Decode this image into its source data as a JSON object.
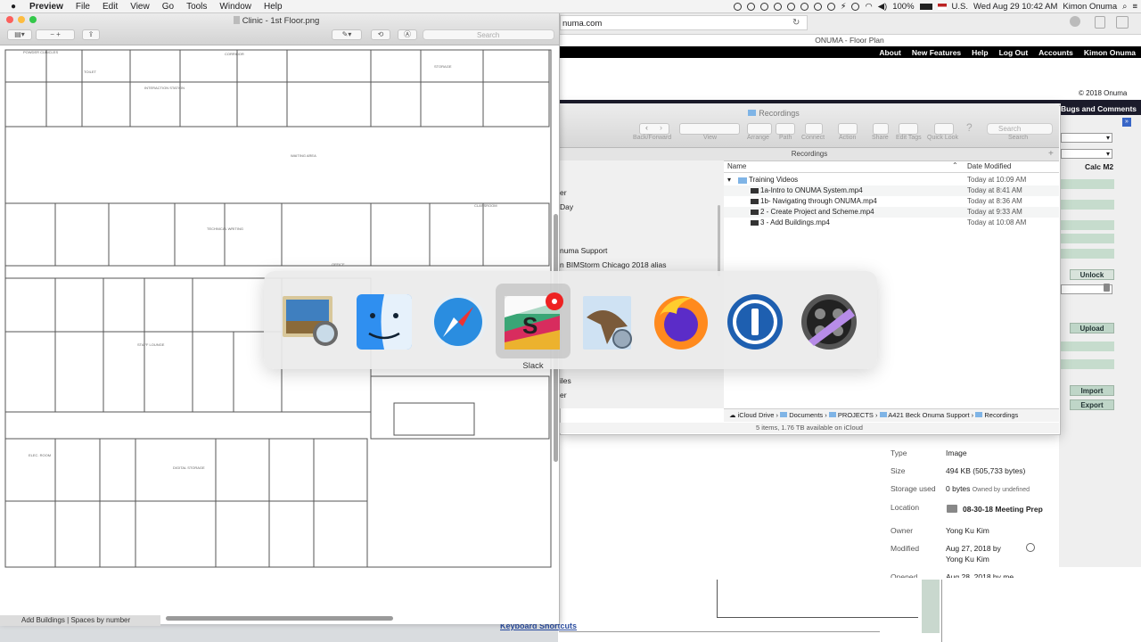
{
  "menubar": {
    "apple": "",
    "items": [
      "Preview",
      "File",
      "Edit",
      "View",
      "Go",
      "Tools",
      "Window",
      "Help"
    ],
    "status": {
      "battery": "100%",
      "input": "U.S.",
      "datetime": "Wed Aug 29  10:42 AM",
      "user": "Kimon Onuma"
    }
  },
  "preview": {
    "title": "Clinic - 1st Floor.png",
    "search_placeholder": "Search",
    "bottom_peek": "Add Buildings | Spaces by number"
  },
  "browser": {
    "address_partial": "numa.com",
    "page_title": "ONUMA - Floor Plan",
    "nav": [
      "About",
      "New Features",
      "Help",
      "Log Out",
      "Accounts",
      "Kimon Onuma"
    ],
    "copyright": "© 2018 Onuma",
    "bugs": "Bugs and Comments",
    "calc": "Calc M2",
    "buttons": {
      "unlock": "Unlock",
      "upload": "Upload",
      "import": "Import",
      "export": "Export"
    },
    "keyboard_shortcuts": "Keyboard Shortcuts"
  },
  "finder": {
    "title": "Recordings",
    "toolbar": [
      "Back/Forward",
      "View",
      "Arrange",
      "Path",
      "Connect",
      "Action",
      "Share",
      "Edit Tags",
      "Quick Look",
      "Search"
    ],
    "search_placeholder": "Search",
    "tab_title": "Recordings",
    "sidebar": [
      "er",
      "Day",
      "numa Support",
      "n BIMStorm Chicago 2018 alias",
      "iles",
      "er"
    ],
    "columns": {
      "name": "Name",
      "date": "Date Modified"
    },
    "rows": [
      {
        "name": "Training Videos",
        "date": "Today at 10:09 AM",
        "folder": true
      },
      {
        "name": "1a-Intro to ONUMA System.mp4",
        "date": "Today at 8:41 AM"
      },
      {
        "name": "1b- Navigating through ONUMA.mp4",
        "date": "Today at 8:36 AM"
      },
      {
        "name": "2 - Create Project and Scheme.mp4",
        "date": "Today at 9:33 AM"
      },
      {
        "name": "3 - Add Buildings.mp4",
        "date": "Today at 10:08 AM"
      }
    ],
    "path": [
      "iCloud Drive",
      "Documents",
      "PROJECTS",
      "A421 Beck Onuma Support",
      "Recordings"
    ],
    "status": "5 items, 1.76 TB available on iCloud"
  },
  "info": {
    "type_label": "Type",
    "type": "Image",
    "size_label": "Size",
    "size": "494 KB (505,733 bytes)",
    "storage_label": "Storage used",
    "storage": "0 bytes",
    "storage_note": "Owned by undefined",
    "location_label": "Location",
    "location": "08-30-18 Meeting Prep",
    "owner_label": "Owner",
    "owner": "Yong Ku Kim",
    "modified_label": "Modified",
    "modified": "Aug 27, 2018 by",
    "modified_by": "Yong Ku Kim",
    "opened_label": "Opened",
    "opened": "Aug 28, 2018 by me"
  },
  "switcher": {
    "apps": [
      "Preview",
      "Finder",
      "Safari",
      "Slack",
      "Mail",
      "Firefox",
      "1Password",
      "Final Cut Pro"
    ],
    "selected_label": "Slack"
  },
  "plan_labels": [
    "POWDER CUBICLES",
    "CORRIDOR",
    "TOILET",
    "STORAGE",
    "WAITING AREA",
    "INTERACTION STATION",
    "TECHNICAL WRITING",
    "OFFICE",
    "CLASSROOM",
    "ELEC. ROOM",
    "STAFF LOUNGE",
    "DIGITAL STORAGE"
  ]
}
